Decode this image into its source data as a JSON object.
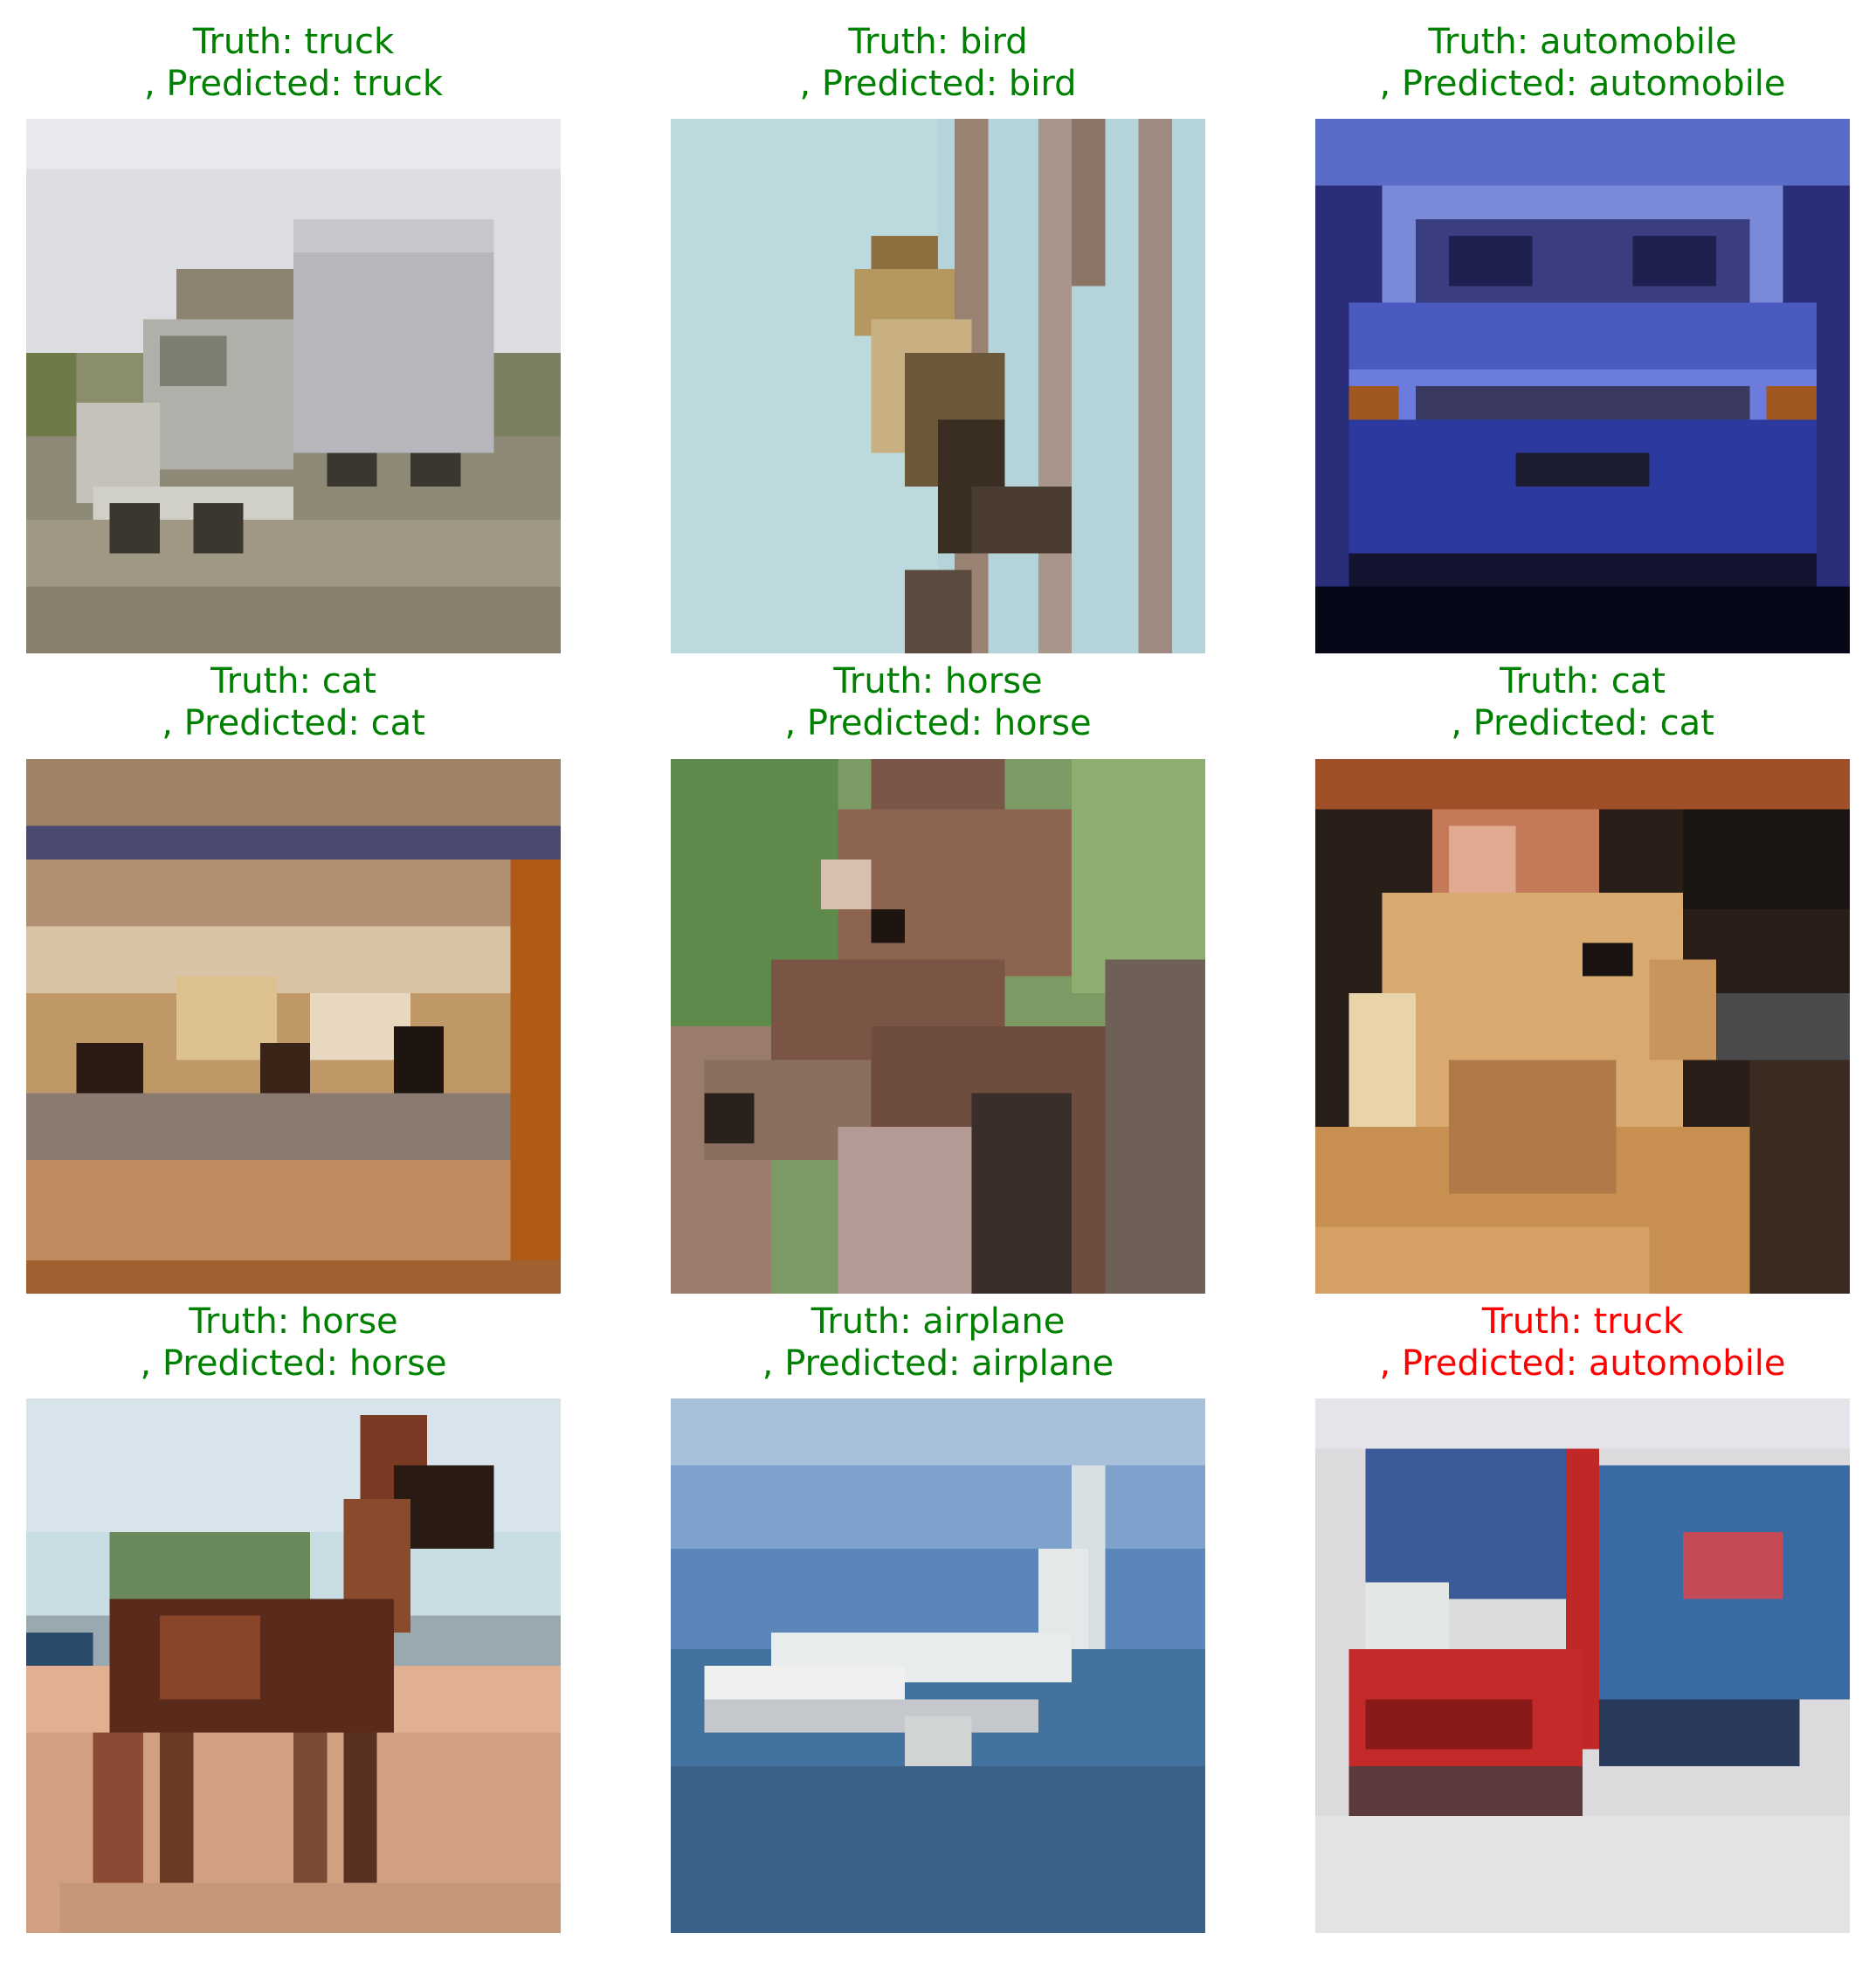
{
  "colors": {
    "correct": "#008000",
    "incorrect": "#ff0000"
  },
  "panels": [
    {
      "truth_line": "Truth: truck",
      "pred_line": ", Predicted: truck",
      "correct": true,
      "subject": "white box truck parked on dirt lot"
    },
    {
      "truth_line": "Truth: bird",
      "pred_line": ", Predicted: bird",
      "correct": true,
      "subject": "brown bird perched on branch against pale blue sky"
    },
    {
      "truth_line": "Truth: automobile",
      "pred_line": ", Predicted: automobile",
      "correct": true,
      "subject": "front view of blue car"
    },
    {
      "truth_line": "Truth: cat",
      "pred_line": ", Predicted: cat",
      "correct": true,
      "subject": "tan and dark blurry animal on cushion"
    },
    {
      "truth_line": "Truth: horse",
      "pred_line": ", Predicted: horse",
      "correct": true,
      "subject": "brown horse head close-up with green foliage"
    },
    {
      "truth_line": "Truth: cat",
      "pred_line": ", Predicted: cat",
      "correct": true,
      "subject": "fluffy orange cat close-up on dark background"
    },
    {
      "truth_line": "Truth: horse",
      "pred_line": ", Predicted: horse",
      "correct": true,
      "subject": "brown horse standing on sand"
    },
    {
      "truth_line": "Truth: airplane",
      "pred_line": ", Predicted: airplane",
      "correct": true,
      "subject": "white airliner flying over blue water"
    },
    {
      "truth_line": "Truth: truck",
      "pred_line": ", Predicted: automobile",
      "correct": false,
      "subject": "red and blue semi truck in snow"
    }
  ]
}
